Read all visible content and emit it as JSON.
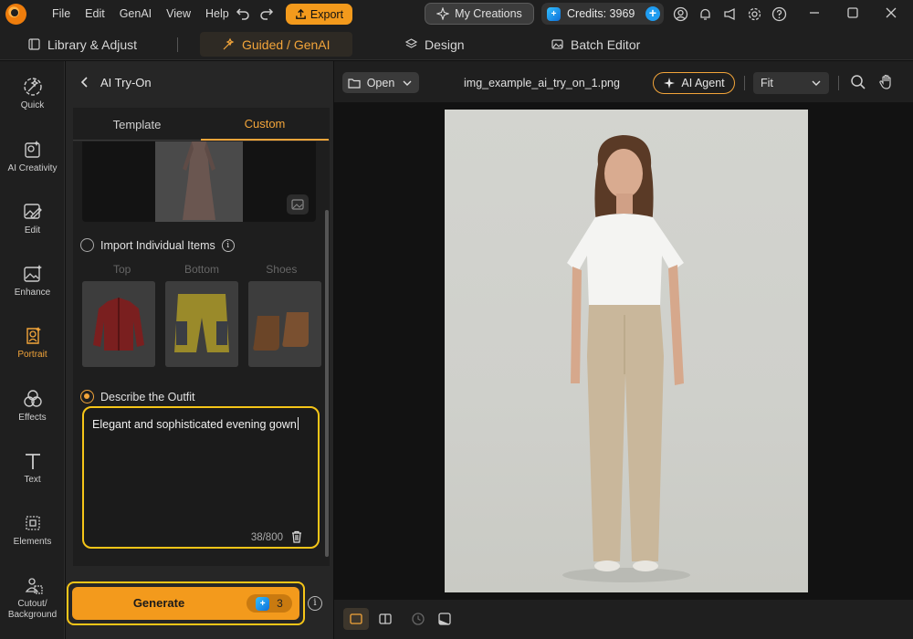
{
  "menu": [
    "File",
    "Edit",
    "GenAI",
    "View",
    "Help"
  ],
  "titlebar": {
    "export_label": "Export",
    "my_creations_label": "My Creations",
    "credits_label": "Credits: 3969"
  },
  "modes": {
    "library": "Library & Adjust",
    "guided": "Guided / GenAI",
    "design": "Design",
    "batch": "Batch Editor"
  },
  "rail": {
    "quick": "Quick",
    "ai_creativity": "AI Creativity",
    "edit": "Edit",
    "enhance": "Enhance",
    "portrait": "Portrait",
    "effects": "Effects",
    "text": "Text",
    "elements": "Elements",
    "cutout_1": "Cutout/",
    "cutout_2": "Background"
  },
  "panel": {
    "title": "AI Try-On",
    "tabs": {
      "template": "Template",
      "custom": "Custom"
    },
    "import_label": "Import Individual Items",
    "categories": [
      "Top",
      "Bottom",
      "Shoes"
    ],
    "describe_label": "Describe the Outfit",
    "description_text": "Elegant and sophisticated evening gown",
    "char_counter": "38/800",
    "generate_label": "Generate",
    "generate_cost": "3"
  },
  "canvas": {
    "open_label": "Open",
    "filename": "img_example_ai_try_on_1.png",
    "ai_agent_label": "AI Agent",
    "zoom_value": "Fit"
  },
  "colors": {
    "accent": "#f39a1c",
    "highlight": "#f5c518"
  }
}
